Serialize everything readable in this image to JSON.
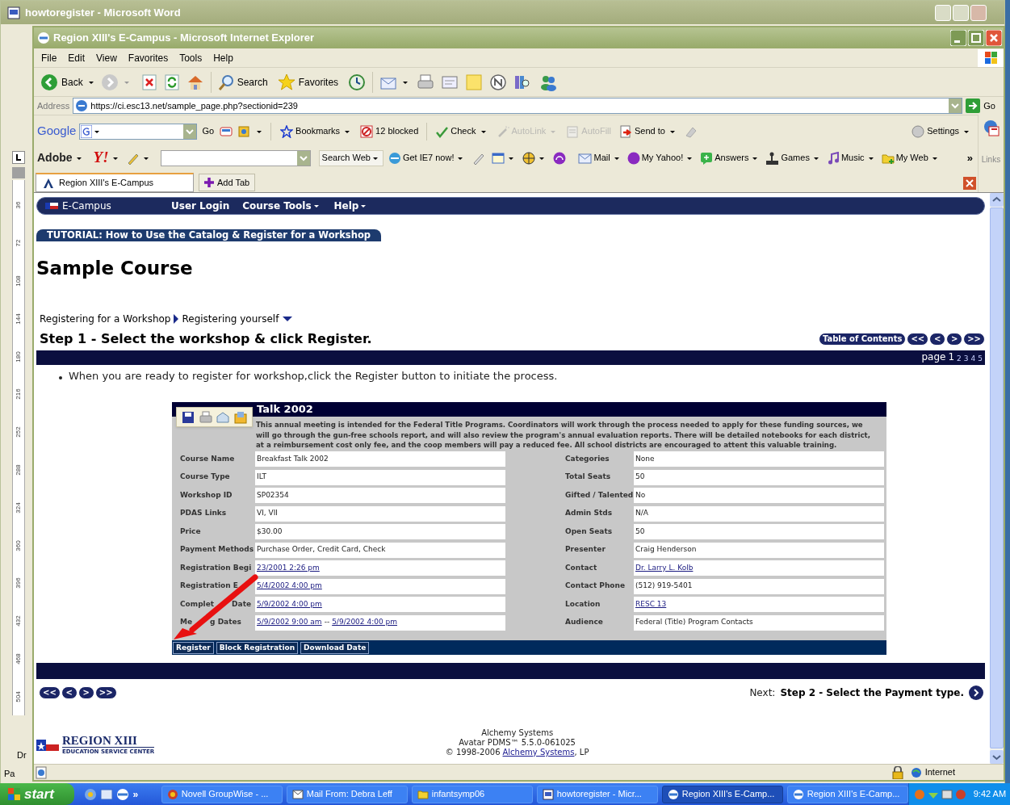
{
  "word_window": {
    "title": "howtoregister - Microsoft Word",
    "ruler_marks": [
      "36",
      "72",
      "108",
      "144",
      "180",
      "216",
      "252",
      "288",
      "324",
      "360",
      "396",
      "432",
      "468",
      "504"
    ],
    "drawing_label": "Dr",
    "page_label": "Pa"
  },
  "browser": {
    "title": "Region XIII's E-Campus - Microsoft Internet Explorer",
    "menu": [
      "File",
      "Edit",
      "View",
      "Favorites",
      "Tools",
      "Help"
    ],
    "toolbar": {
      "back": "Back",
      "search": "Search",
      "favorites": "Favorites"
    },
    "address": {
      "label": "Address",
      "value": "https://ci.esc13.net/sample_page.php?sectionid=239",
      "go": "Go"
    },
    "google_bar": {
      "logo": "Google",
      "go": "Go",
      "items": [
        {
          "label": "Bookmarks",
          "menu": true,
          "disabled": false
        },
        {
          "label": "12 blocked",
          "menu": false,
          "disabled": false
        },
        {
          "label": "Check",
          "menu": true,
          "disabled": false
        },
        {
          "label": "AutoLink",
          "menu": true,
          "disabled": true
        },
        {
          "label": "AutoFill",
          "menu": false,
          "disabled": true
        },
        {
          "label": "Send to",
          "menu": true,
          "disabled": false
        }
      ],
      "settings": "Settings"
    },
    "yahoo_bar": {
      "adobe": "Adobe",
      "yahoo": "Y!",
      "search": "Search Web",
      "items": [
        {
          "label": "Get IE7 now!",
          "menu": true
        },
        {
          "label": "Mail",
          "menu": true
        },
        {
          "label": "My Yahoo!",
          "menu": true
        },
        {
          "label": "Answers",
          "menu": true
        },
        {
          "label": "Games",
          "menu": true
        },
        {
          "label": "Music",
          "menu": true
        },
        {
          "label": "My Web",
          "menu": true
        }
      ],
      "more": "»",
      "links": "Links"
    },
    "tabs": [
      {
        "label": "Region XIII's E-Campus",
        "selected": true
      }
    ],
    "add_tab": "Add Tab",
    "status": {
      "zone": "Internet"
    }
  },
  "page": {
    "nav": {
      "brand": "E-Campus",
      "items": [
        {
          "label": "User Login",
          "menu": false
        },
        {
          "label": "Course Tools",
          "menu": true
        },
        {
          "label": "Help",
          "menu": true
        }
      ]
    },
    "tutorial": "TUTORIAL: How to Use the Catalog & Register for a Workshop",
    "title": "Sample Course",
    "breadcrumb": [
      "Registering for a Workshop",
      "Registering yourself"
    ],
    "step": "Step 1 - Select the workshop & click Register.",
    "toc": "Table of Contents",
    "pager": [
      "<<",
      "<",
      ">",
      ">>"
    ],
    "pages_label": "page",
    "pages": [
      {
        "label": "1",
        "selected": true
      },
      {
        "label": "2",
        "selected": false
      },
      {
        "label": "3",
        "selected": false
      },
      {
        "label": "4",
        "selected": false
      },
      {
        "label": "5",
        "selected": false
      }
    ],
    "bullet": "When you are ready to register for workshop,click the Register button to initiate the process.",
    "workshop": {
      "header": "Talk 2002",
      "description": "This annual meeting is intended for the Federal Title Programs. Coordinators will work through the process needed to apply for these funding sources, we will go through the gun-free schools report, and will also review the program's annual evaluation reports. There will be detailed notebooks for each district, at a reimbursement cost only fee, and the coop members will pay a reduced fee. All school districts are encouraged to attent this valuable training.",
      "left_rows": [
        {
          "label": "Course Name",
          "value": "Breakfast Talk 2002",
          "link": false
        },
        {
          "label": "Course Type",
          "value": "ILT",
          "link": false
        },
        {
          "label": "Workshop ID",
          "value": "SP02354",
          "link": false
        },
        {
          "label": "PDAS Links",
          "value": "VI, VII",
          "link": false
        },
        {
          "label": "Price",
          "value": "$30.00",
          "link": false
        },
        {
          "label": "Payment Methods",
          "value": "Purchase Order, Credit Card, Check",
          "link": false
        },
        {
          "label": "Registration Begi",
          "value": "23/2001 2:26 pm",
          "link": true
        },
        {
          "label": "Registration E",
          "value": "5/4/2002 4:00 pm",
          "link": true
        },
        {
          "label": "Complet",
          "label_after": "Date",
          "value": "5/9/2002 4:00 pm",
          "link": true
        },
        {
          "label": "Me",
          "label_after": "g Dates",
          "value": "5/9/2002 9:00 am",
          "separator": "--",
          "value_end": "5/9/2002 4:00 pm",
          "link": true
        }
      ],
      "right_rows": [
        {
          "label": "Categories",
          "value": "None",
          "link": false
        },
        {
          "label": "Total Seats",
          "value": "50",
          "link": false
        },
        {
          "label": "Gifted / Talented",
          "value": "No",
          "link": false
        },
        {
          "label": "Admin Stds",
          "value": "N/A",
          "link": false
        },
        {
          "label": "Open Seats",
          "value": "50",
          "link": false
        },
        {
          "label": "Presenter",
          "value": "Craig Henderson",
          "link": false
        },
        {
          "label": "Contact",
          "value": "Dr. Larry L. Kolb",
          "link": true
        },
        {
          "label": "Contact Phone",
          "value": "(512) 919-5401",
          "link": false
        },
        {
          "label": "Location",
          "value": "RESC 13",
          "link": true
        },
        {
          "label": "Audience",
          "value": "Federal (Title) Program Contacts",
          "link": false
        }
      ],
      "buttons": [
        "Register",
        "Block Registration",
        "Download Date"
      ]
    },
    "bottom_pager": [
      "<<",
      "<",
      ">",
      ">>"
    ],
    "next_label": "Next:",
    "next_step": "Step 2 - Select the Payment type.",
    "logo": {
      "name": "REGION XIII",
      "subtitle": "EDUCATION SERVICE CENTER"
    },
    "footer": {
      "lines": [
        "Alchemy Systems",
        "Avatar PDMS™ 5.5.0-061025"
      ],
      "copyright_before": "© 1998-2006",
      "copyright_link": "Alchemy Systems",
      "copyright_after": ", LP"
    }
  },
  "taskbar": {
    "start": "start",
    "more": "»",
    "tasks": [
      {
        "label": "Novell GroupWise - ...",
        "selected": false
      },
      {
        "label": "Mail From: Debra Leff",
        "selected": false
      },
      {
        "label": "infantsymp06",
        "selected": false
      },
      {
        "label": "howtoregister - Micr...",
        "selected": false
      },
      {
        "label": "Region XIII's E-Camp...",
        "selected": true
      },
      {
        "label": "Region XIII's E-Camp...",
        "selected": false
      }
    ],
    "clock": "9:42 AM"
  }
}
